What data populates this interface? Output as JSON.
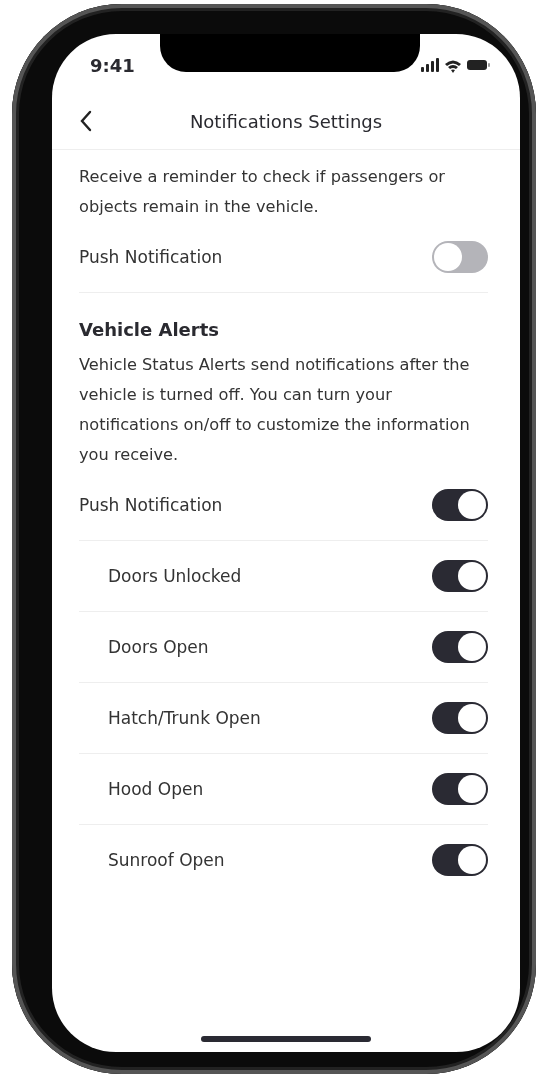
{
  "status_bar": {
    "time": "9:41"
  },
  "header": {
    "title": "Notifications Settings"
  },
  "sections": [
    {
      "description": "Receive a reminder to check if passengers or objects remain in the vehicle.",
      "settings": [
        {
          "kind": "main",
          "label": "Push Notification",
          "on": false
        }
      ]
    },
    {
      "title": "Vehicle Alerts",
      "description": "Vehicle Status Alerts send notifications after the vehicle is turned off. You can turn your notifications on/off to customize the information you receive.",
      "settings": [
        {
          "kind": "main",
          "label": "Push Notification",
          "on": true
        },
        {
          "kind": "sub",
          "label": "Doors Unlocked",
          "on": true
        },
        {
          "kind": "sub",
          "label": "Doors Open",
          "on": true
        },
        {
          "kind": "sub",
          "label": "Hatch/Trunk Open",
          "on": true
        },
        {
          "kind": "sub",
          "label": "Hood Open",
          "on": true
        },
        {
          "kind": "sub",
          "label": "Sunroof Open",
          "on": true
        }
      ]
    }
  ]
}
